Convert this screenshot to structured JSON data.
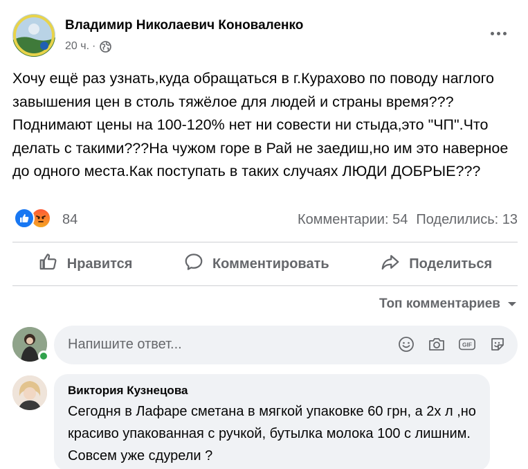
{
  "post": {
    "author": "Владимир Николаевич Коноваленко",
    "time": "20 ч.",
    "separator": "·",
    "text": "Хочу ещё раз узнать,куда обращаться в г.Курахово по поводу наглого завышения цен в столь тяжёлое для людей и страны время???Поднимают цены на 100-120% нет ни совести ни стыда,это \"ЧП\".Что делать с такими???На чужом горе в Рай не заедиш,но им это наверное до одного места.Как поступать в таких случаях ЛЮДИ ДОБРЫЕ???"
  },
  "reactions": {
    "count": "84",
    "comments": "Комментарии: 54",
    "shares": "Поделились: 13",
    "types": [
      "like",
      "angry"
    ]
  },
  "actions": {
    "like": "Нравится",
    "comment": "Комментировать",
    "share": "Поделиться"
  },
  "sort": {
    "label": "Топ комментариев"
  },
  "compose": {
    "placeholder": "Напишите ответ...",
    "icons": [
      "emoji-icon",
      "camera-icon",
      "gif-icon",
      "sticker-icon"
    ]
  },
  "comment": {
    "author": "Виктория Кузнецова",
    "text": "Сегодня в Лафаре сметана в мягкой упаковке 60 грн, а 2х л ,но красиво упакованная с ручкой, бутылка молока 100 с лишним. Совсем уже сдурели ?"
  },
  "colors": {
    "accent": "#1877f2",
    "secondary_text": "#65676b",
    "bubble": "#f0f2f5",
    "online": "#31a24c"
  }
}
